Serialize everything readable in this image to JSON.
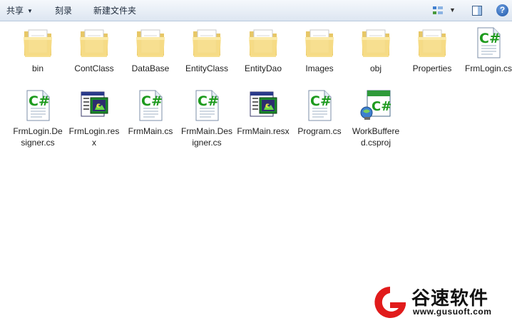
{
  "toolbar": {
    "share_label": "共享",
    "burn_label": "刻录",
    "new_folder_label": "新建文件夹"
  },
  "items": [
    {
      "label": "bin",
      "icon": "folder-icon"
    },
    {
      "label": "ContClass",
      "icon": "folder-icon"
    },
    {
      "label": "DataBase",
      "icon": "folder-icon"
    },
    {
      "label": "EntityClass",
      "icon": "folder-icon"
    },
    {
      "label": "EntityDao",
      "icon": "folder-icon"
    },
    {
      "label": "Images",
      "icon": "folder-icon"
    },
    {
      "label": "obj",
      "icon": "folder-icon"
    },
    {
      "label": "Properties",
      "icon": "folder-icon"
    },
    {
      "label": "FrmLogin.cs",
      "icon": "csharp-file-icon"
    },
    {
      "label": "FrmLogin.Designer.cs",
      "icon": "csharp-file-icon"
    },
    {
      "label": "FrmLogin.resx",
      "icon": "resx-file-icon"
    },
    {
      "label": "FrmMain.cs",
      "icon": "csharp-file-icon"
    },
    {
      "label": "FrmMain.Designer.cs",
      "icon": "csharp-file-icon"
    },
    {
      "label": "FrmMain.resx",
      "icon": "resx-file-icon"
    },
    {
      "label": "Program.cs",
      "icon": "csharp-file-icon"
    },
    {
      "label": "WorkBuffered.csproj",
      "icon": "csproj-file-icon"
    }
  ],
  "watermark": {
    "title": "谷速软件",
    "url": "www.gusuoft.com"
  }
}
